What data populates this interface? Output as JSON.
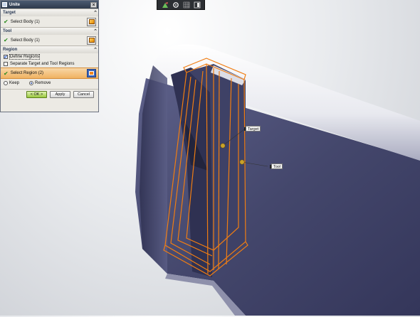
{
  "toolbar": {
    "icons": [
      "snap-icon",
      "gear-icon",
      "grid-icon",
      "layout-icon"
    ]
  },
  "dialog": {
    "title": "Unite",
    "target": {
      "header": "Target",
      "select_label": "Select Body (1)"
    },
    "tool": {
      "header": "Tool",
      "select_label": "Select Body (1)"
    },
    "region": {
      "header": "Region",
      "define_regions_label": "Define Regions",
      "define_regions_checked": true,
      "separate_label": "Separate Target and Tool Regions",
      "separate_checked": false,
      "select_region_label": "Select Region (2)",
      "keep_label": "Keep",
      "remove_label": "Remove",
      "selected_option": "Remove"
    },
    "buttons": {
      "ok": "< OK >",
      "apply": "Apply",
      "cancel": "Cancel"
    }
  },
  "canvas": {
    "target_tag": "Target",
    "tool_tag": "Tool",
    "colors": {
      "body": "#43466b",
      "highlight": "#f07d12",
      "marker": "#c9a22a"
    }
  }
}
